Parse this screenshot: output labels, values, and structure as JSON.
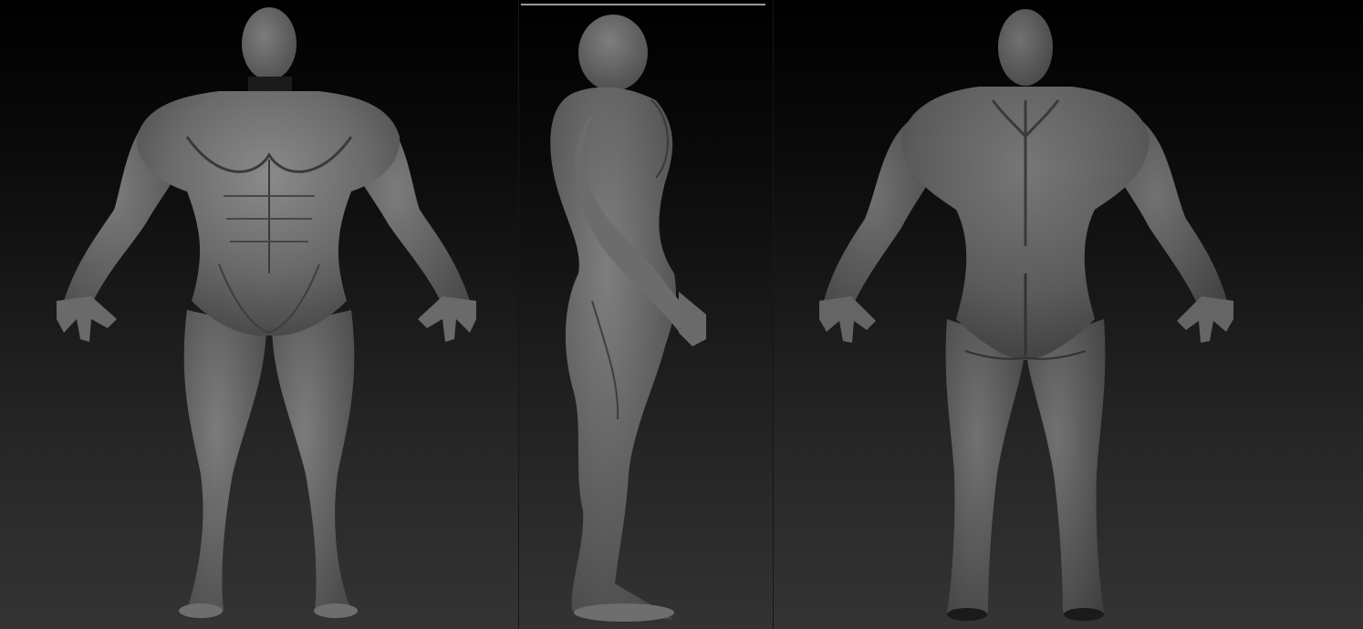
{
  "views": [
    {
      "id": "front",
      "icon": "sculpt-front-view"
    },
    {
      "id": "side",
      "icon": "sculpt-side-view"
    },
    {
      "id": "back",
      "icon": "sculpt-back-view"
    }
  ],
  "colors": {
    "skin_light": "#8a8a8a",
    "skin_mid": "#6a6a6a",
    "skin_dark": "#3e3e3e",
    "line": "#3a3a3a",
    "background_top": "#000000",
    "background_bottom": "#343434",
    "divider": "#161616"
  }
}
